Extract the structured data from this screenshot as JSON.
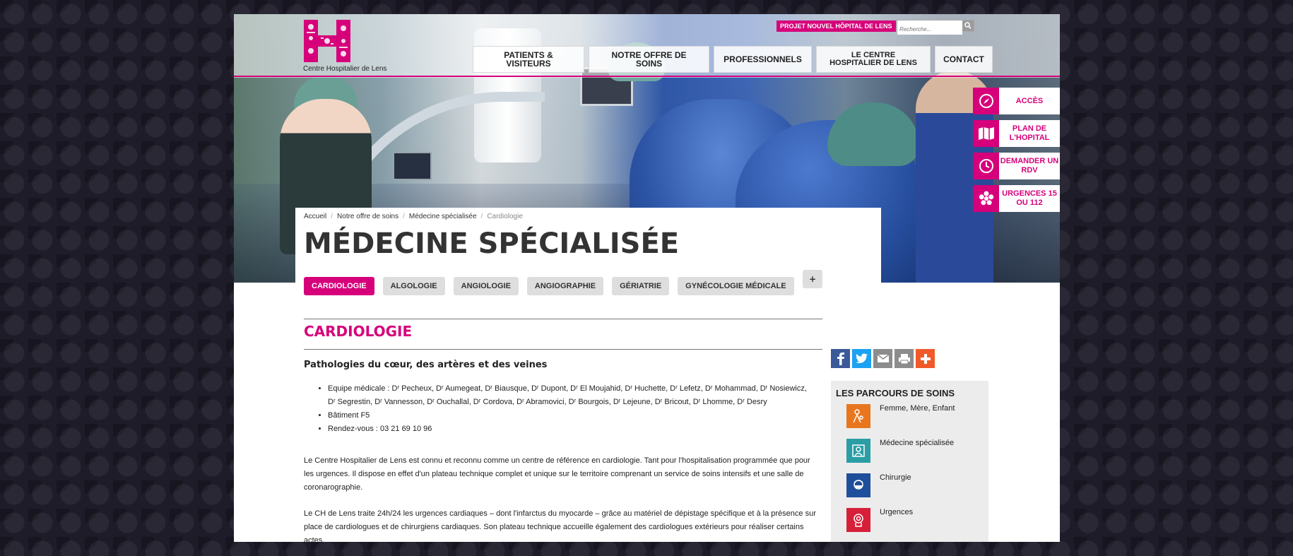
{
  "header": {
    "logo_text": "Centre Hospitalier de Lens",
    "project_button": "PROJET NOUVEL HÔPITAL DE LENS",
    "search_placeholder": "Recherche...",
    "nav": [
      {
        "label": "PATIENTS & VISITEURS"
      },
      {
        "label": "NOTRE OFFRE DE SOINS"
      },
      {
        "label": "PROFESSIONNELS"
      },
      {
        "label": "LE CENTRE HOSPITALIER DE LENS"
      },
      {
        "label": "CONTACT"
      }
    ]
  },
  "side_buttons": [
    {
      "label": "ACCÈS",
      "icon": "compass-icon"
    },
    {
      "label": "PLAN DE L'HOPITAL",
      "icon": "map-icon"
    },
    {
      "label": "DEMANDER UN RDV",
      "icon": "clock-icon"
    },
    {
      "label": "URGENCES 15 OU 112",
      "icon": "asterisk-icon"
    }
  ],
  "breadcrumb": [
    "Accueil",
    "Notre offre de soins",
    "Médecine spécialisée",
    "Cardiologie"
  ],
  "page_title": "MÉDECINE SPÉCIALISÉE",
  "tabs": [
    "CARDIOLOGIE",
    "ALGOLOGIE",
    "ANGIOLOGIE",
    "ANGIOGRAPHIE",
    "GÉRIATRIE",
    "GYNÉCOLOGIE MÉDICALE"
  ],
  "tabs_more": "+",
  "section": {
    "title": "CARDIOLOGIE",
    "subtitle": "Pathologies du cœur, des artères et des veines",
    "bullets": [
      "Equipe médicale : Dʳ Pecheux, Dʳ Aumegeat, Dʳ Biausque, Dʳ Dupont, Dʳ El Moujahid, Dʳ Huchette, Dʳ Lefetz, Dʳ Mohammad, Dʳ Nosiewicz, Dʳ Segrestin, Dʳ Vannesson, Dʳ Ouchallal, Dʳ Cordova, Dʳ Abramovici, Dʳ Bourgois, Dʳ Lejeune, Dʳ Bricout, Dʳ Lhomme, Dʳ Desry",
      "Bâtiment F5",
      "Rendez-vous : 03 21 69 10 96"
    ],
    "paragraphs": [
      "Le Centre Hospitalier de Lens est connu et reconnu comme un centre de référence en cardiologie. Tant pour l'hospitalisation programmée que pour les urgences. Il dispose en effet d'un plateau technique complet et unique sur le territoire comprenant un service de soins intensifs et une salle de coronarographie.",
      "Le CH de Lens traite 24h/24 les urgences cardiaques – dont l'infarctus du myocarde – grâce au matériel de dépistage spécifique et à la présence sur place de cardiologues et de chirurgiens cardiaques. Son plateau technique accueille également des cardiologues extérieurs pour réaliser certains actes."
    ]
  },
  "share_icons": [
    "facebook-icon",
    "twitter-icon",
    "email-icon",
    "print-icon",
    "plus-share-icon"
  ],
  "parcours": {
    "title": "LES PARCOURS DE SOINS",
    "items": [
      {
        "label": "Femme, Mère, Enfant",
        "color": "#e8761e"
      },
      {
        "label": "Médecine spécialisée",
        "color": "#2a9da5"
      },
      {
        "label": "Chirurgie",
        "color": "#1f4e9b"
      },
      {
        "label": "Urgences",
        "color": "#d6203a"
      }
    ]
  },
  "colors": {
    "accent": "#d6007a"
  }
}
